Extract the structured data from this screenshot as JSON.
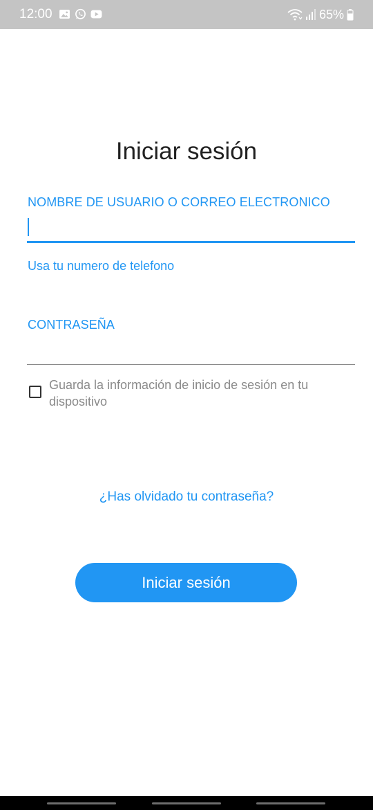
{
  "status_bar": {
    "time": "12:00",
    "left_icons": [
      "gallery-icon",
      "whatsapp-icon",
      "youtube-icon"
    ],
    "right_icons": [
      "wifi-icon",
      "signal-icon",
      "battery-icon"
    ],
    "battery": "65%"
  },
  "login": {
    "title": "Iniciar sesión",
    "username_label": "NOMBRE DE USUARIO O CORREO ELECTRONICO",
    "username_value": "",
    "phone_link": "Usa tu numero de telefono",
    "password_label": "CONTRASEÑA",
    "password_value": "",
    "remember_label": "Guarda la información de inicio de sesión en tu dispositivo",
    "remember_checked": false,
    "forgot_link": "¿Has olvidado tu contraseña?",
    "submit_label": "Iniciar sesión"
  },
  "colors": {
    "accent": "#2196f3",
    "status_bar_bg": "#c4c4c4",
    "muted_text": "#8a8a8a",
    "title_text": "#212121"
  }
}
